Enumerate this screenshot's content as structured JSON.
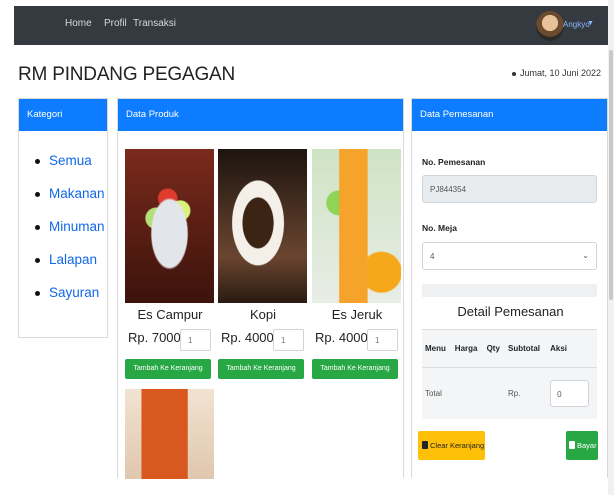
{
  "navbar": {
    "links": [
      "Home",
      "Profil",
      "Transaksi"
    ],
    "user_name": "Angkyo",
    "caret_icon": "caret-down-icon"
  },
  "header": {
    "brand": "RM PINDANG PEGAGAN",
    "date": "Jumat, 10 Juni 2022"
  },
  "kategori": {
    "title": "Kategori",
    "items": [
      "Semua",
      "Makanan",
      "Minuman",
      "Lalapan",
      "Sayuran"
    ]
  },
  "produk": {
    "title": "Data Produk",
    "items": [
      {
        "name": "Es Campur",
        "price": "Rp. 7000",
        "qty": "1",
        "button": "Tambah Ke Keranjang"
      },
      {
        "name": "Kopi",
        "price": "Rp. 4000",
        "qty": "1",
        "button": "Tambah Ke Keranjang"
      },
      {
        "name": "Es Jeruk",
        "price": "Rp. 4000",
        "qty": "1",
        "button": "Tambah Ke Keranjang"
      }
    ]
  },
  "pesanan": {
    "title": "Data Pemesanan",
    "no_pemesanan_label": "No. Pemesanan",
    "no_pemesanan_value": "PJ844354",
    "no_meja_label": "No. Meja",
    "no_meja_value": "4",
    "detail_title": "Detail Pemesanan",
    "columns": [
      "Menu",
      "Harga",
      "Qty",
      "Subtotal",
      "Aksi"
    ],
    "total_label": "Total",
    "total_currency": "Rp.",
    "total_value": "0",
    "clear_button": "Clear Keranjang",
    "pay_button": "Bayar"
  },
  "colors": {
    "primary": "#0d7cff",
    "success": "#28a745",
    "warning": "#ffc107",
    "navbar": "#343a40"
  }
}
